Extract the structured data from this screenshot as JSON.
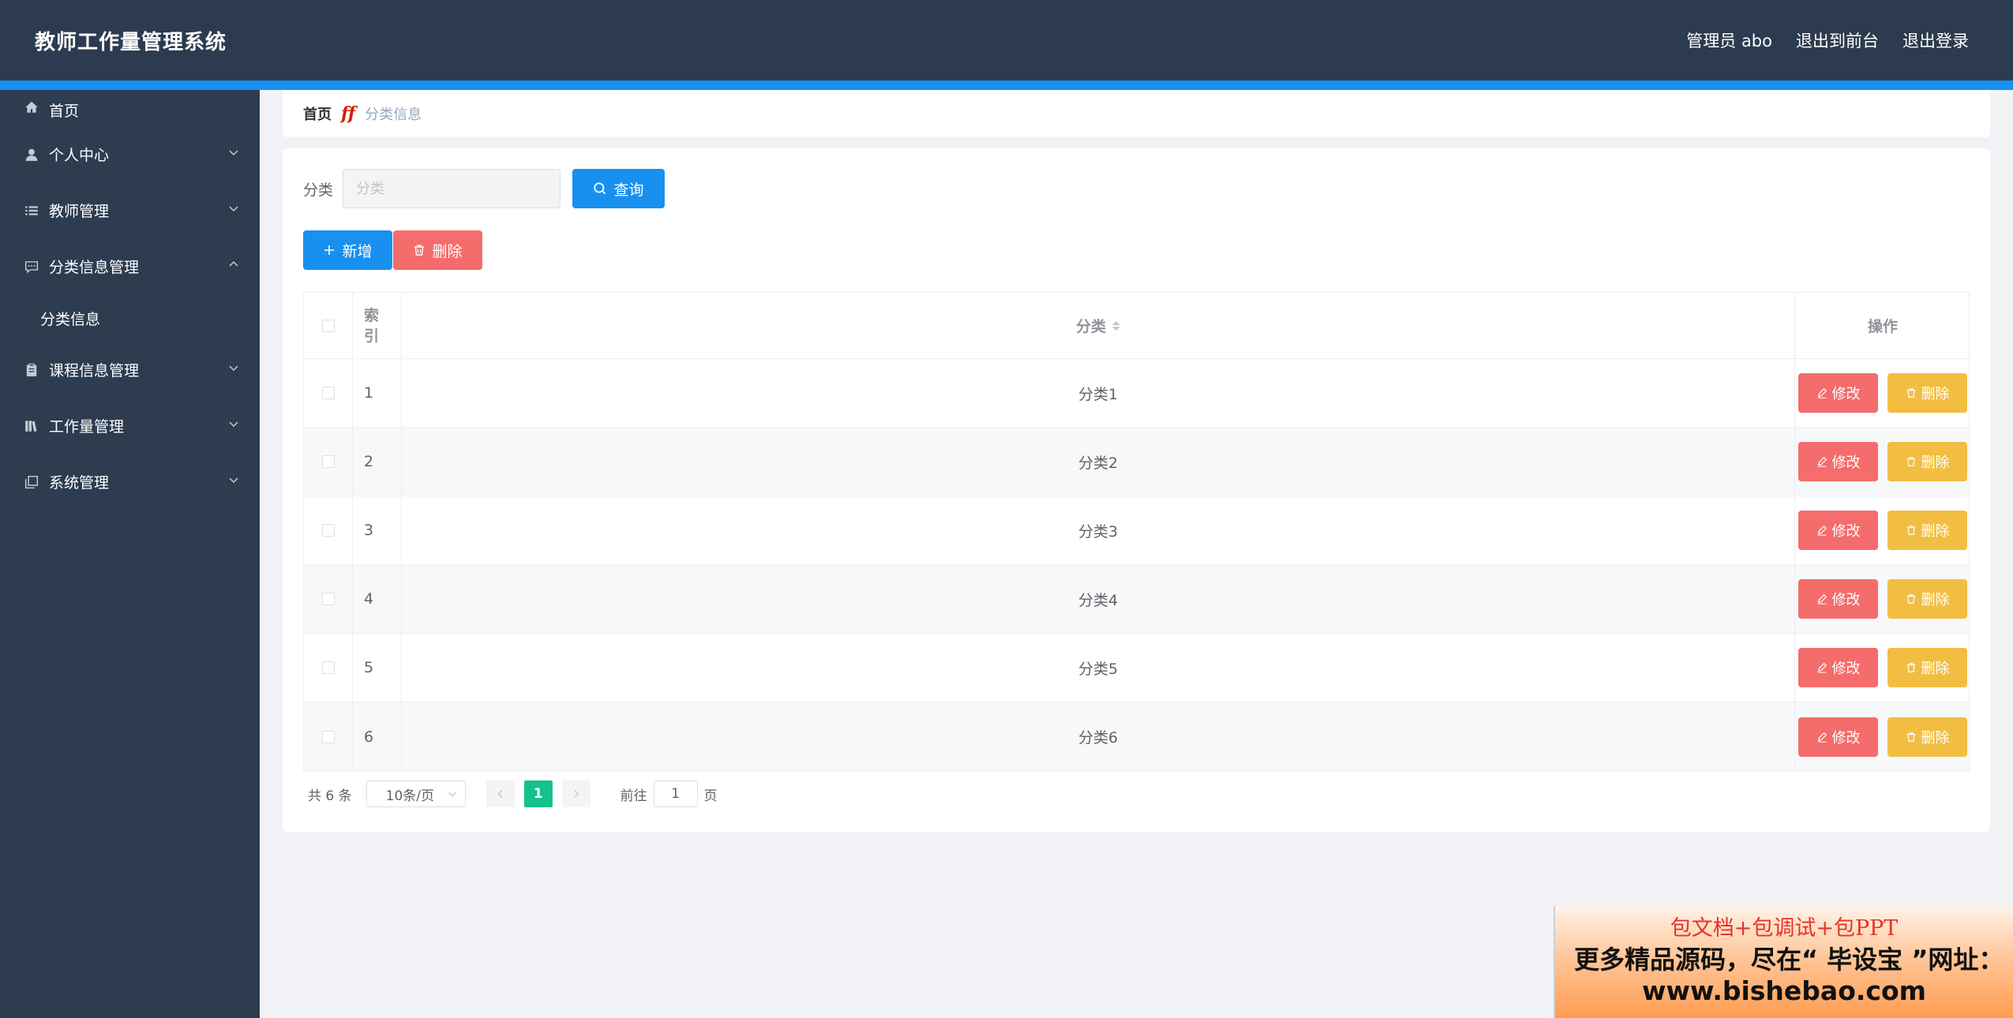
{
  "header": {
    "title": "教师工作量管理系统",
    "admin": "管理员 abo",
    "exit_front": "退出到前台",
    "logout": "退出登录"
  },
  "sidebar": {
    "items": [
      {
        "label": "首页",
        "icon": "home-icon"
      },
      {
        "label": "个人中心",
        "icon": "user-icon"
      },
      {
        "label": "教师管理",
        "icon": "list-icon"
      },
      {
        "label": "分类信息管理",
        "icon": "chat-icon",
        "expanded": true
      },
      {
        "label": "课程信息管理",
        "icon": "clipboard-icon"
      },
      {
        "label": "工作量管理",
        "icon": "library-icon"
      },
      {
        "label": "系统管理",
        "icon": "copy-icon"
      }
    ],
    "submenu": {
      "label": "分类信息"
    }
  },
  "breadcrumb": {
    "home": "首页",
    "current": "分类信息"
  },
  "search": {
    "label": "分类",
    "placeholder": "分类",
    "value": "",
    "query_label": "查询"
  },
  "toolbar": {
    "add_label": "新增",
    "delete_label": "删除"
  },
  "table": {
    "headers": {
      "index": "索引",
      "category": "分类",
      "actions": "操作"
    },
    "edit_label": "修改",
    "delete_label": "删除",
    "rows": [
      {
        "index": "1",
        "category": "分类1"
      },
      {
        "index": "2",
        "category": "分类2"
      },
      {
        "index": "3",
        "category": "分类3"
      },
      {
        "index": "4",
        "category": "分类4"
      },
      {
        "index": "5",
        "category": "分类5"
      },
      {
        "index": "6",
        "category": "分类6"
      }
    ]
  },
  "pagination": {
    "total": "共 6 条",
    "page_size": "10条/页",
    "current_page": "1",
    "goto_label": "前往",
    "goto_value": "1",
    "page_suffix": "页"
  },
  "ad": {
    "line1": "包文档+包调试+包PPT",
    "line2": "更多精品源码，尽在“ 毕设宝 ”网址：",
    "line3": "www.bishebao.com"
  },
  "colors": {
    "header_bg": "#2c3b4f",
    "sidebar_bg": "#2e3c50",
    "primary": "#1890f0",
    "danger": "#f56c6c",
    "warning": "#f2be42",
    "pager_active": "#13c28c"
  }
}
